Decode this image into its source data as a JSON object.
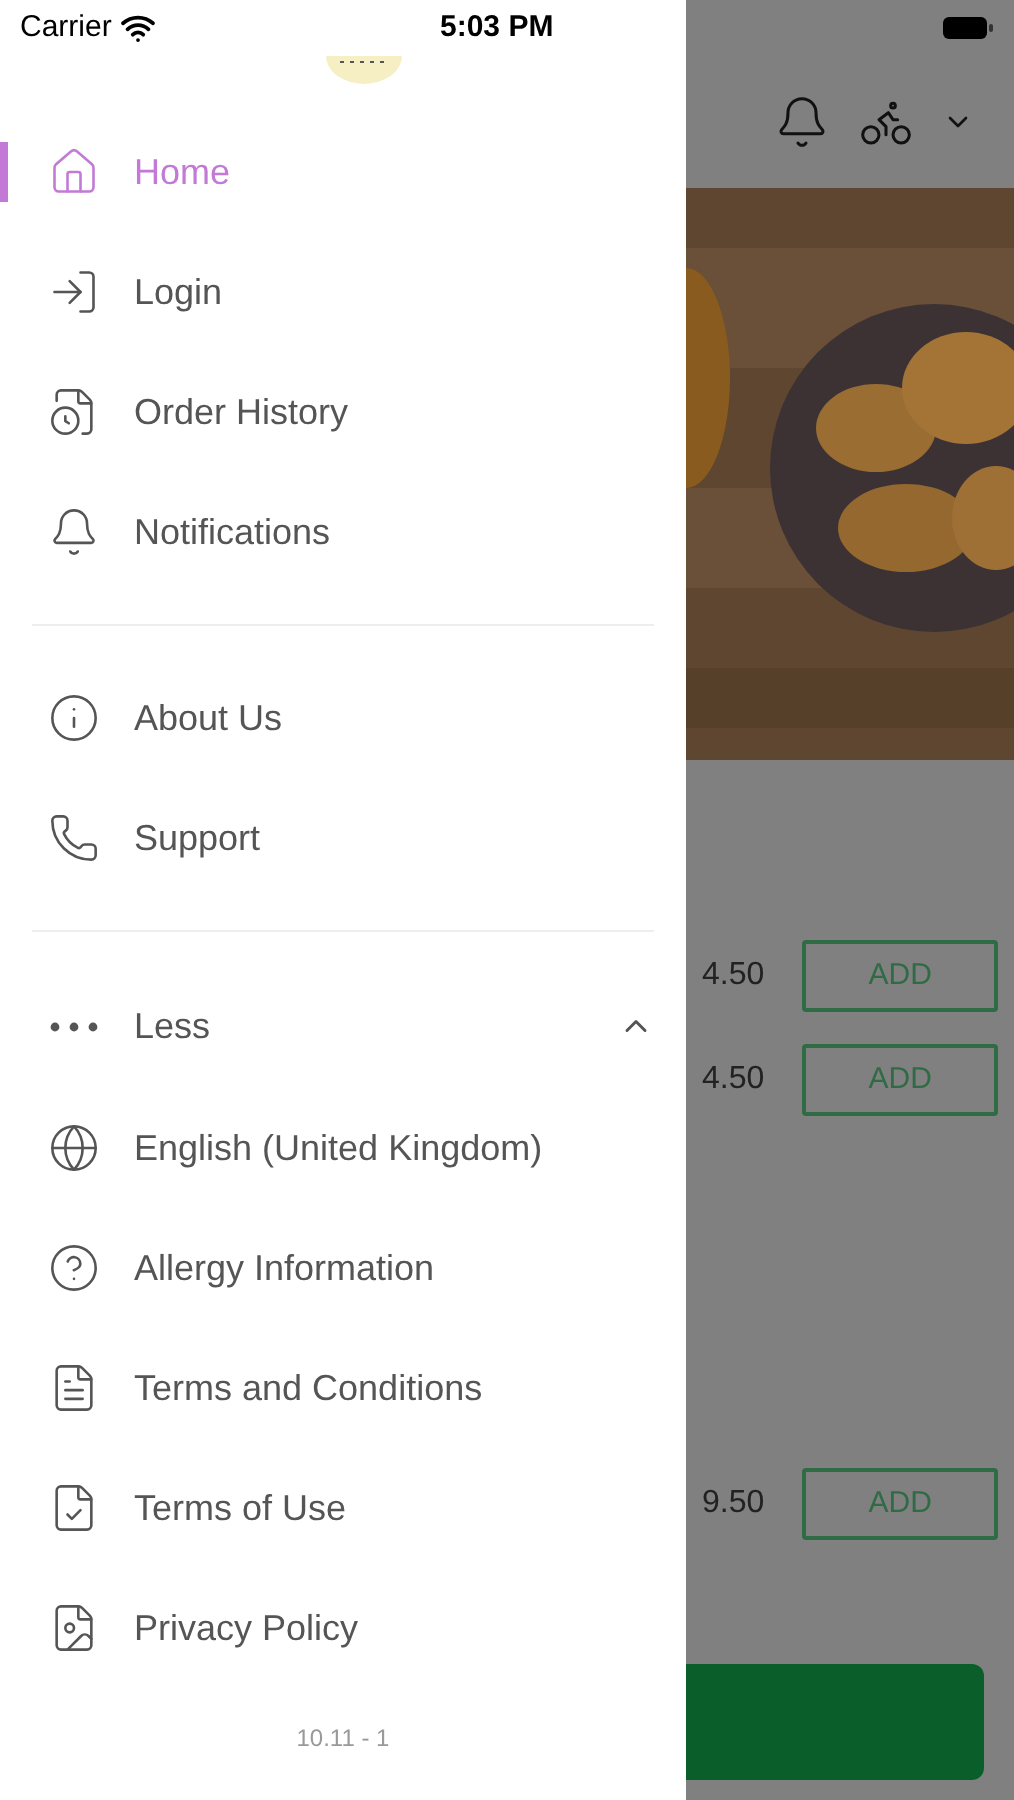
{
  "status_bar": {
    "carrier": "Carrier",
    "time": "5:03 PM"
  },
  "menu": {
    "sections": [
      {
        "items": [
          {
            "label": "Home",
            "selected": true
          },
          {
            "label": "Login",
            "selected": false
          },
          {
            "label": "Order History",
            "selected": false
          },
          {
            "label": "Notifications",
            "selected": false
          }
        ]
      },
      {
        "items": [
          {
            "label": "About Us",
            "selected": false
          },
          {
            "label": "Support",
            "selected": false
          }
        ]
      }
    ],
    "more_toggle": {
      "label": "Less",
      "expanded": true
    },
    "more_items": [
      {
        "label": "English (United Kingdom)",
        "selected": false
      },
      {
        "label": "Allergy Information",
        "selected": false
      },
      {
        "label": "Terms and Conditions",
        "selected": false
      },
      {
        "label": "Terms of Use",
        "selected": false
      },
      {
        "label": "Privacy Policy",
        "selected": false
      }
    ],
    "version": "10.11 - 1"
  },
  "background": {
    "products": [
      {
        "price": "4.50",
        "button": "ADD"
      },
      {
        "price": "4.50",
        "button": "ADD"
      },
      {
        "price": "9.50",
        "button": "ADD"
      }
    ]
  }
}
